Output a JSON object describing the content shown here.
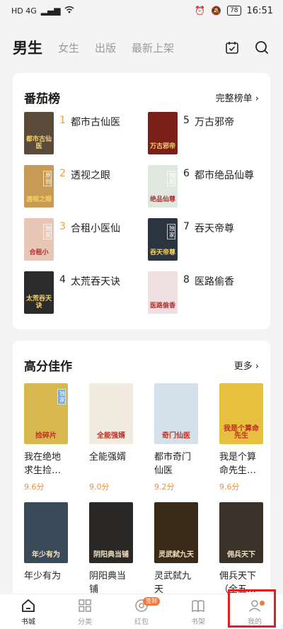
{
  "status_bar": {
    "left": "HD 4G",
    "battery": "78",
    "time": "16:51"
  },
  "header": {
    "tabs": [
      {
        "label": "男生",
        "active": true
      },
      {
        "label": "女生",
        "active": false
      },
      {
        "label": "出版",
        "active": false
      },
      {
        "label": "最新上架",
        "active": false
      }
    ]
  },
  "ranking": {
    "title": "番茄榜",
    "more": "完整榜单 ›",
    "items": [
      {
        "num": "1",
        "name": "都市古仙医",
        "color": "#5a4a3a",
        "tag": "",
        "cover_text": "都市古仙医"
      },
      {
        "num": "5",
        "name": "万古邪帝",
        "color": "#7a2018",
        "tag": "",
        "cover_text": "万古邪帝"
      },
      {
        "num": "2",
        "name": "透视之眼",
        "color": "#c79a55",
        "tag": "原创",
        "cover_text": "透视之眼"
      },
      {
        "num": "6",
        "name": "都市绝品仙尊",
        "color": "#dfe8df",
        "tag": "独家",
        "cover_text": "绝品仙尊"
      },
      {
        "num": "3",
        "name": "合租小医仙",
        "color": "#e8c6b6",
        "tag": "独家",
        "cover_text": "合租小"
      },
      {
        "num": "7",
        "name": "吞天帝尊",
        "color": "#2a3540",
        "tag": "独家",
        "cover_text": "吞天帝尊"
      },
      {
        "num": "4",
        "name": "太荒吞天诀",
        "color": "#2b2b2b",
        "tag": "",
        "cover_text": "太荒吞天诀"
      },
      {
        "num": "8",
        "name": "医路偷香",
        "color": "#eee0e0",
        "tag": "",
        "cover_text": "医路偷香"
      }
    ]
  },
  "high_score": {
    "title": "高分佳作",
    "more": "更多 ›",
    "books": [
      {
        "title": "我在绝地求生捡…",
        "score": "9.6分",
        "color": "#d8b850",
        "tag": "独家",
        "cover_text": "捡碎片"
      },
      {
        "title": "全能强婿",
        "score": "9.0分",
        "color": "#f2ebe0",
        "tag": "",
        "cover_text": "全能强婿"
      },
      {
        "title": "都市奇门仙医",
        "score": "9.2分",
        "color": "#d5e1ea",
        "tag": "",
        "cover_text": "奇门仙医"
      },
      {
        "title": "我是个算命先生…",
        "score": "9.6分",
        "color": "#e8c040",
        "tag": "",
        "cover_text": "我是个算命先生"
      },
      {
        "title": "年少有为",
        "score": "",
        "color": "#3a4a58",
        "tag": "",
        "cover_text": "年少有为"
      },
      {
        "title": "阴阳典当铺",
        "score": "",
        "color": "#2b2828",
        "tag": "",
        "cover_text": "阴阳典当铺"
      },
      {
        "title": "灵武弑九天",
        "score": "",
        "color": "#3a2a18",
        "tag": "",
        "cover_text": "灵武弑九天"
      },
      {
        "title": "佣兵天下（全五…",
        "score": "",
        "color": "#3a3228",
        "tag": "",
        "cover_text": "佣兵天下"
      }
    ]
  },
  "bottom_nav": {
    "items": [
      {
        "label": "书城",
        "active": true,
        "icon": "home-icon"
      },
      {
        "label": "分类",
        "active": false,
        "icon": "grid-icon"
      },
      {
        "label": "红包",
        "active": false,
        "icon": "coin-icon",
        "badge": "签到"
      },
      {
        "label": "书架",
        "active": false,
        "icon": "book-icon"
      },
      {
        "label": "我的",
        "active": false,
        "icon": "person-icon"
      }
    ]
  }
}
